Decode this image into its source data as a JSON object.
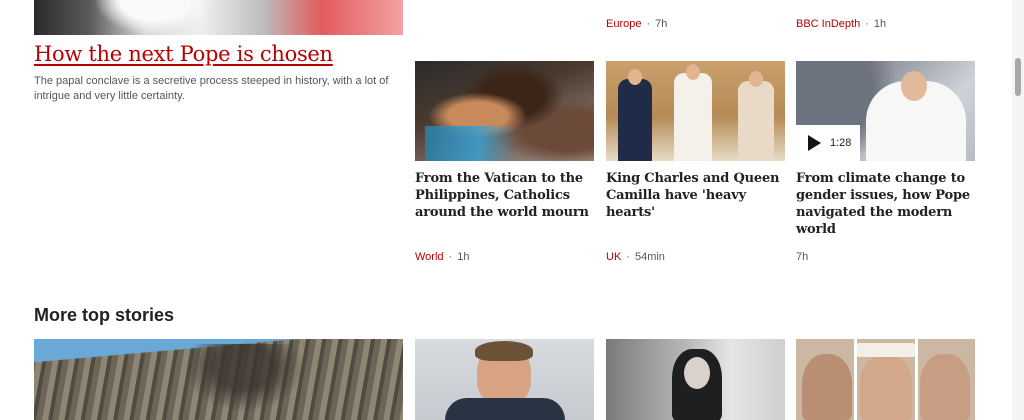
{
  "hero": {
    "headline": "How the next Pope is chosen",
    "summary": "The papal conclave is a secretive process steeped in history, with a lot of intrigue and very little certainty."
  },
  "top_meta": [
    {
      "section": "Europe",
      "time": "7h"
    },
    {
      "section": "BBC InDepth",
      "time": "1h"
    }
  ],
  "cards": [
    {
      "headline": "From the Vatican to the Philippines, Catholics around the world mourn",
      "section": "World",
      "time": "1h",
      "image": "praying-woman"
    },
    {
      "headline": "King Charles and Queen Camilla have 'heavy hearts'",
      "section": "UK",
      "time": "54min",
      "image": "king-and-pope"
    },
    {
      "headline": "From climate change to gender issues, how Pope navigated the modern world",
      "section": "",
      "time": "7h",
      "image": "pope-waving",
      "video_duration": "1:28"
    }
  ],
  "more_top_stories": {
    "title": "More top stories",
    "images": [
      "damaged-building",
      "man-in-suit",
      "woman-portrait",
      "three-men"
    ]
  },
  "icons": {
    "play": "play-icon"
  },
  "colors": {
    "accent": "#b80000",
    "text": "#202224",
    "muted": "#545658"
  }
}
